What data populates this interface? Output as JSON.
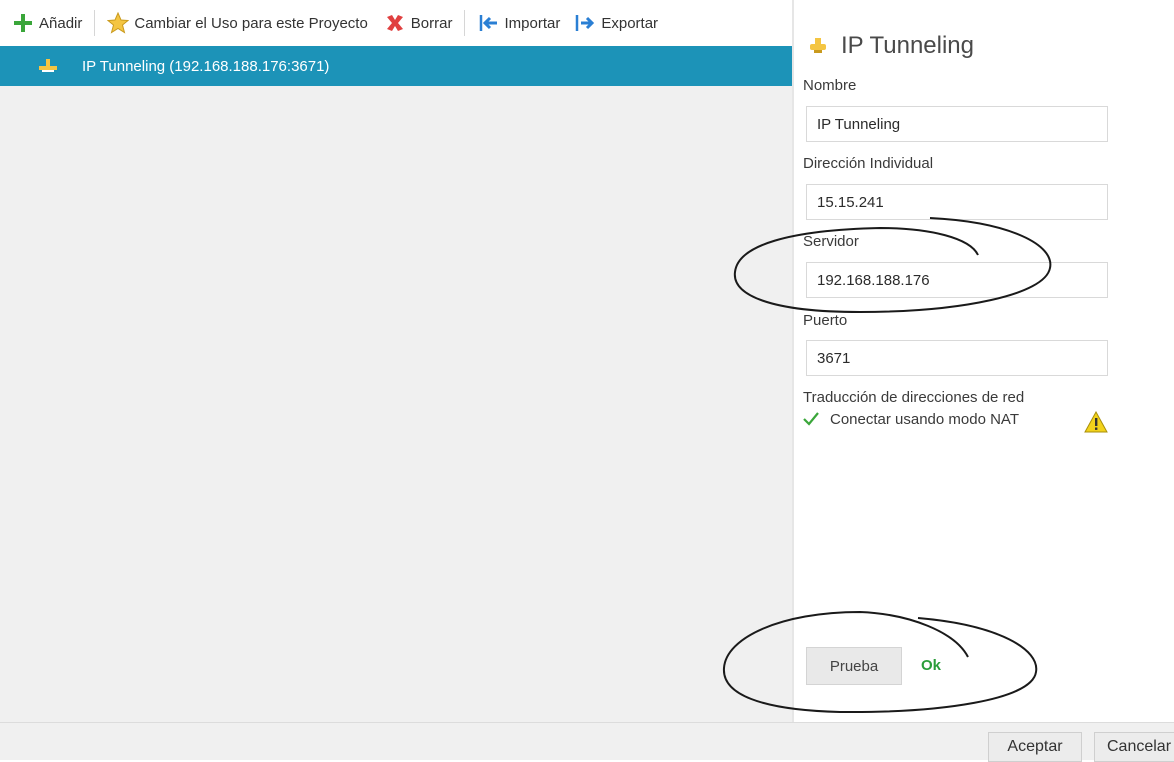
{
  "toolbar": {
    "add_label": "Añadir",
    "change_use_label": "Cambiar el Uso para este Proyecto",
    "delete_label": "Borrar",
    "import_label": "Importar",
    "export_label": "Exportar"
  },
  "connections": [
    {
      "label": "IP Tunneling (192.168.188.176:3671)",
      "selected": true
    }
  ],
  "panel": {
    "title": "IP Tunneling",
    "name_label": "Nombre",
    "name_value": "IP Tunneling",
    "address_label": "Dirección Individual",
    "address_value": "15.15.241",
    "server_label": "Servidor",
    "server_value": "192.168.188.176",
    "port_label": "Puerto",
    "port_value": "3671",
    "nat_section_label": "Traducción de direcciones de red",
    "nat_checkbox_label": "Conectar usando modo NAT",
    "nat_checked": true,
    "test_button": "Prueba",
    "test_result": "Ok"
  },
  "footer": {
    "accept_label": "Aceptar",
    "cancel_label": "Cancelar"
  },
  "colors": {
    "selection": "#1c93b8",
    "ok_green": "#2a9d3a",
    "add_green": "#3aa63a",
    "delete_red": "#e04040",
    "arrow_blue": "#2a7fd4"
  },
  "icons": [
    "plus-icon",
    "star-icon",
    "delete-x-icon",
    "import-arrow-icon",
    "export-arrow-icon",
    "ip-tunnel-icon",
    "checkmark-icon",
    "warning-icon"
  ]
}
